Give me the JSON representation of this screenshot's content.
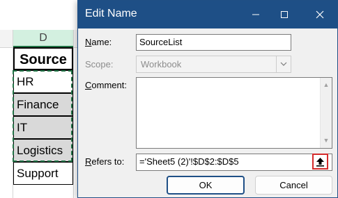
{
  "sheet": {
    "column_header": "D",
    "cells": [
      "Source",
      "HR",
      "Finance",
      "IT",
      "Logistics",
      "Support"
    ]
  },
  "dialog": {
    "title": "Edit Name",
    "name_label": "Name:",
    "name_value": "SourceList",
    "scope_label": "Scope:",
    "scope_value": "Workbook",
    "comment_label": "Comment:",
    "comment_value": "",
    "refers_to_label": "Refers to:",
    "refers_to_value": "='Sheet5 (2)'!$D$2:$D$5",
    "ok_label": "OK",
    "cancel_label": "Cancel"
  },
  "icons": {
    "minimize": "minimize-icon",
    "maximize": "maximize-icon",
    "close": "close-icon",
    "dropdown": "chevron-down-icon",
    "collapse_dialog": "collapse-dialog-icon"
  },
  "colors": {
    "titlebar": "#1e4f86",
    "marching_ants": "#217346",
    "highlight_box": "#d52b2b",
    "selected_cells": "#d9d9d9"
  }
}
